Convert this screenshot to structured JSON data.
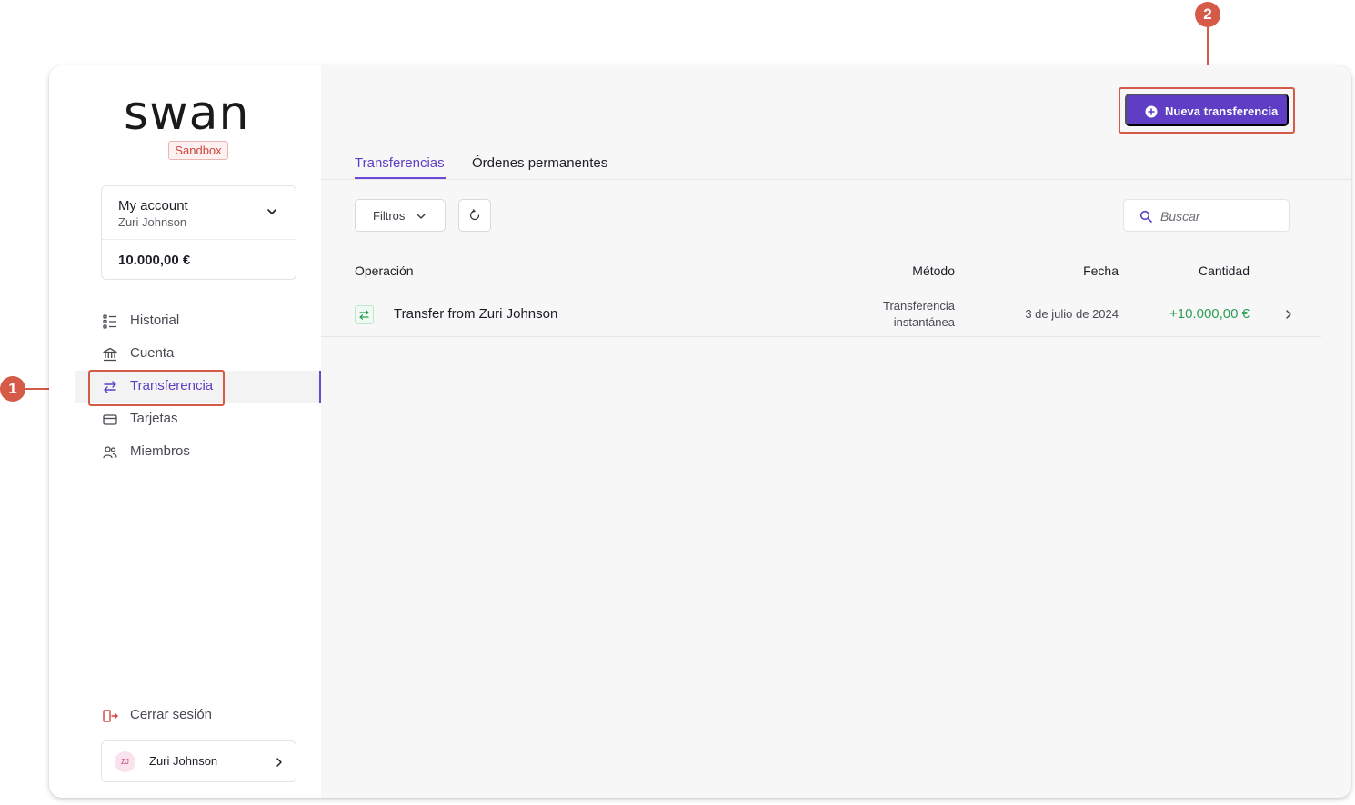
{
  "brand": {
    "logo": "swan",
    "env_badge": "Sandbox"
  },
  "account": {
    "name": "My account",
    "holder": "Zuri Johnson",
    "balance": "10.000,00 €"
  },
  "nav": {
    "items": [
      {
        "label": "Historial",
        "icon": "list-icon"
      },
      {
        "label": "Cuenta",
        "icon": "bank-icon"
      },
      {
        "label": "Transferencia",
        "icon": "transfer-icon",
        "active": true
      },
      {
        "label": "Tarjetas",
        "icon": "card-icon"
      },
      {
        "label": "Miembros",
        "icon": "members-icon"
      }
    ],
    "logout": "Cerrar sesión"
  },
  "user": {
    "initials": "ZJ",
    "name": "Zuri Johnson"
  },
  "toolbar": {
    "new_transfer": "Nueva transferencia",
    "filters": "Filtros",
    "search_placeholder": "Buscar"
  },
  "tabs": [
    {
      "label": "Transferencias",
      "active": true
    },
    {
      "label": "Órdenes permanentes",
      "active": false
    }
  ],
  "table": {
    "headers": {
      "operation": "Operación",
      "method": "Método",
      "date": "Fecha",
      "amount": "Cantidad"
    },
    "rows": [
      {
        "operation": "Transfer from Zuri Johnson",
        "method_line1": "Transferencia",
        "method_line2": "instantánea",
        "date": "3 de julio de 2024",
        "amount": "+10.000,00 €"
      }
    ]
  },
  "callouts": {
    "first": "1",
    "second": "2"
  },
  "colors": {
    "accent": "#5f3dc4",
    "positive": "#2e9e56",
    "callout": "#d65a48"
  }
}
